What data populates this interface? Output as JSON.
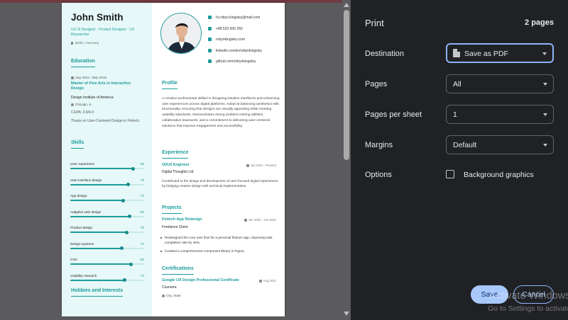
{
  "resume": {
    "name": "John Smith",
    "subtitle": "UX UI Designer · Product Designer · UX Researcher",
    "location": "Berlin, Germany",
    "education": {
      "title": "Education",
      "date": "Sep 2015 - May 2019",
      "degree": "Master of Fine Arts in Interaction Design",
      "school": "Design Institute of America",
      "city": "Chicago, IL",
      "gpa": "CGPA: 3.9/4.0",
      "thesis": "Thesis on User-Centered Design in Fintech."
    },
    "skills_title": "Skills",
    "skills": [
      {
        "name": "User experience",
        "value": "85",
        "level": 0.85
      },
      {
        "name": "User interface design",
        "value": "78",
        "level": 0.78
      },
      {
        "name": "App design",
        "value": "72",
        "level": 0.72
      },
      {
        "name": "Adaptive web design",
        "value": "80",
        "level": 0.8
      },
      {
        "name": "Product design",
        "value": "76",
        "level": 0.76
      },
      {
        "name": "Design systems",
        "value": "70",
        "level": 0.7
      },
      {
        "name": "CSS",
        "value": "82",
        "level": 0.82
      },
      {
        "name": "Usability research",
        "value": "74",
        "level": 0.74
      }
    ],
    "hobbies_title": "Hobbies and Interests",
    "contacts": [
      {
        "icon": "mail-icon",
        "text": "hi.robyn.kingsley@mail.com"
      },
      {
        "icon": "phone-icon",
        "text": "+88 533 000 250"
      },
      {
        "icon": "globe-icon",
        "text": "robynkingsley.com"
      },
      {
        "icon": "linkedin-icon",
        "text": "linkedin.com/in/robynkingsley"
      },
      {
        "icon": "github-icon",
        "text": "github.com/robynkingsley"
      }
    ],
    "profile": {
      "title": "Profile",
      "text": "A creative professional skilled in designing intuitive interfaces and enhancing user experiences across digital platforms. Adept at balancing aesthetics with functionality, ensuring that designs are visually appealing while meeting usability standards. Demonstrates strong problem-solving abilities, collaborative teamwork, and a commitment to delivering user-centered solutions that improve engagement and accessibility."
    },
    "experience": {
      "title": "Experience",
      "role": "UI/UX Engineer",
      "date": "Jan 2021 - Present",
      "company": "Digital Thoughts Ltd",
      "text": "Contributed to the design and development of user-focused digital experiences by bridging creative design with technical implementation."
    },
    "projects": {
      "title": "Projects",
      "name": "Fintech App Redesign",
      "date": "Jan 2022 - Jun 2022",
      "client": "Freelance Client",
      "bullets": [
        "Redesigned the core user flow for a personal finance app, improving task completion rate by 40%.",
        "Created a comprehensive component library in Figma."
      ]
    },
    "certifications": {
      "title": "Certifications",
      "name": "Google UX Design Professional Certificate",
      "date": "Aug 2021",
      "issuer": "Coursera",
      "city": "City, State"
    }
  },
  "print": {
    "title": "Print",
    "page_count": "2 pages",
    "destination_label": "Destination",
    "destination_value": "Save as PDF",
    "pages_label": "Pages",
    "pages_value": "All",
    "per_sheet_label": "Pages per sheet",
    "per_sheet_value": "1",
    "margins_label": "Margins",
    "margins_value": "Default",
    "options_label": "Options",
    "background_graphics_label": "Background graphics",
    "save_label": "Save",
    "cancel_label": "Cancel"
  },
  "watermark": {
    "title": "Activate Windows",
    "subtitle": "Go to Settings to activate Windows."
  }
}
